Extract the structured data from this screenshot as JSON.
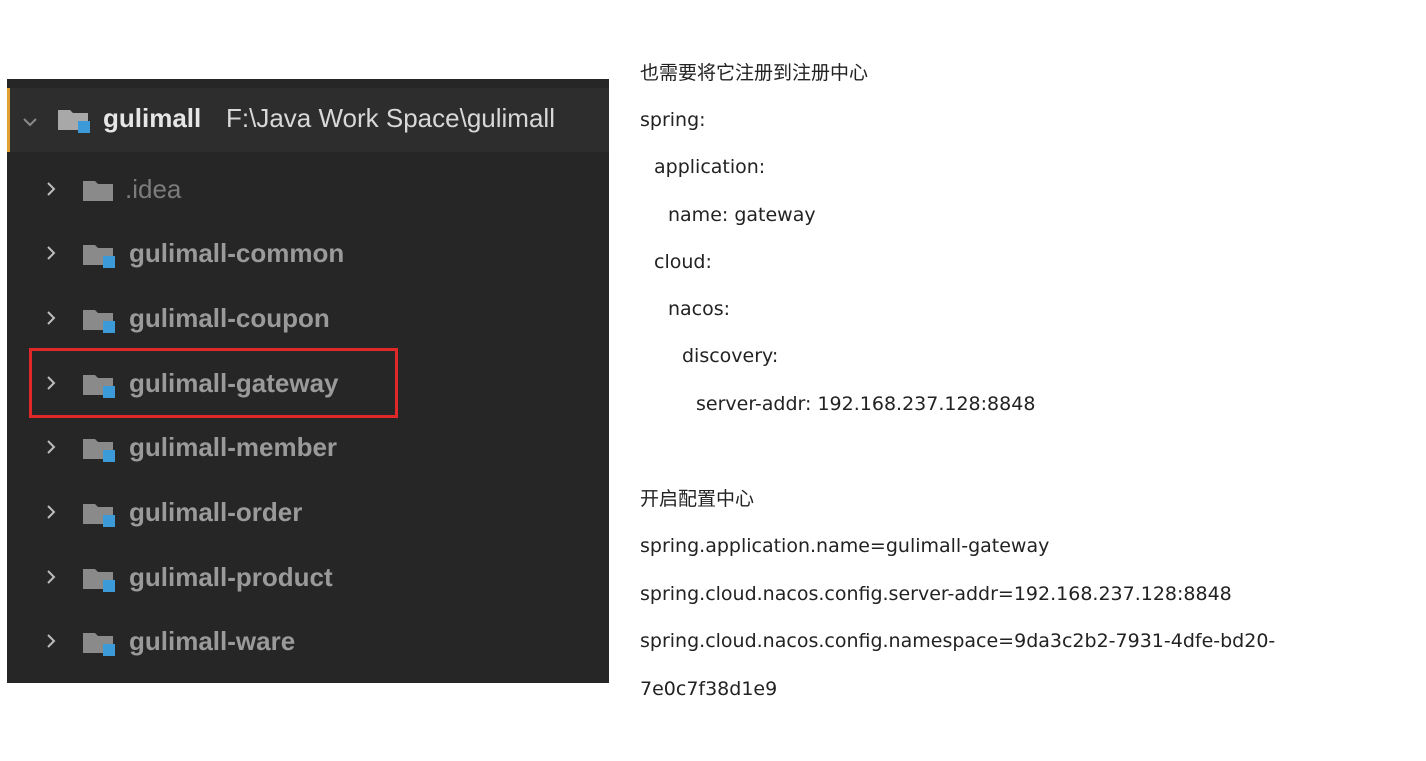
{
  "project_tree": {
    "root": {
      "name": "gulimall",
      "path": "F:\\Java Work Space\\gulimall",
      "expanded": true
    },
    "items": [
      {
        "label": ".idea",
        "kind": "folder"
      },
      {
        "label": "gulimall-common",
        "kind": "module"
      },
      {
        "label": "gulimall-coupon",
        "kind": "module"
      },
      {
        "label": "gulimall-gateway",
        "kind": "module",
        "highlighted": true
      },
      {
        "label": "gulimall-member",
        "kind": "module"
      },
      {
        "label": "gulimall-order",
        "kind": "module"
      },
      {
        "label": "gulimall-product",
        "kind": "module"
      },
      {
        "label": "gulimall-ware",
        "kind": "module"
      }
    ],
    "colors": {
      "background": "#262626",
      "root_background": "#2d2d2d",
      "accent_bar": "#e0a030",
      "highlight_border": "#e02828",
      "folder_gray": "#8a8a8a",
      "module_badge": "#3d9ad9"
    }
  },
  "notes": {
    "registry_heading": "也需要将它注册到注册中心",
    "registry_yaml": [
      "spring:",
      "application:",
      "name: gateway",
      "cloud:",
      "nacos:",
      "discovery:",
      "server-addr: 192.168.237.128:8848"
    ],
    "config_heading": "开启配置中心",
    "config_lines": [
      "spring.application.name=gulimall-gateway",
      "spring.cloud.nacos.config.server-addr=192.168.237.128:8848",
      "spring.cloud.nacos.config.namespace=9da3c2b2-7931-4dfe-bd20-",
      "7e0c7f38d1e9"
    ]
  }
}
